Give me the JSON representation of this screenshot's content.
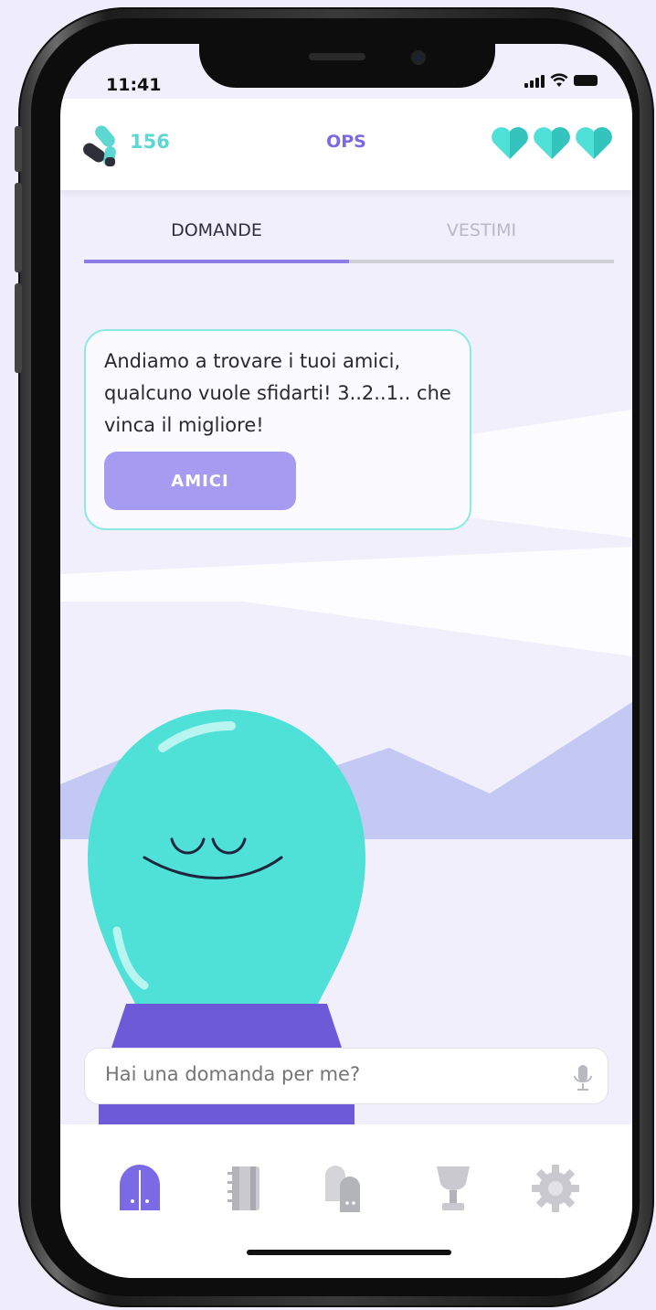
{
  "status": {
    "time": "11:41"
  },
  "header": {
    "score": "156",
    "title": "OPS",
    "hearts_count": 3
  },
  "tabs": [
    {
      "label": "DOMANDE",
      "active": true
    },
    {
      "label": "VESTIMI",
      "active": false
    }
  ],
  "bubble": {
    "message": "Andiamo a trovare i tuoi amici, qualcuno vuole sfidarti! 3..2..1.. che vinca il migliore!",
    "button_label": "AMICI"
  },
  "ask_input": {
    "placeholder": "Hai una domanda per me?"
  },
  "tabbar": {
    "items": [
      "home-icon",
      "notebook-icon",
      "chess-pieces-icon",
      "trophy-icon",
      "settings-gear-icon"
    ],
    "active_index": 0
  },
  "colors": {
    "accent": "#7b6ae6",
    "teal": "#4fe0d8",
    "button": "#a59bf0",
    "inactive_icon": "#c9c9cf"
  }
}
